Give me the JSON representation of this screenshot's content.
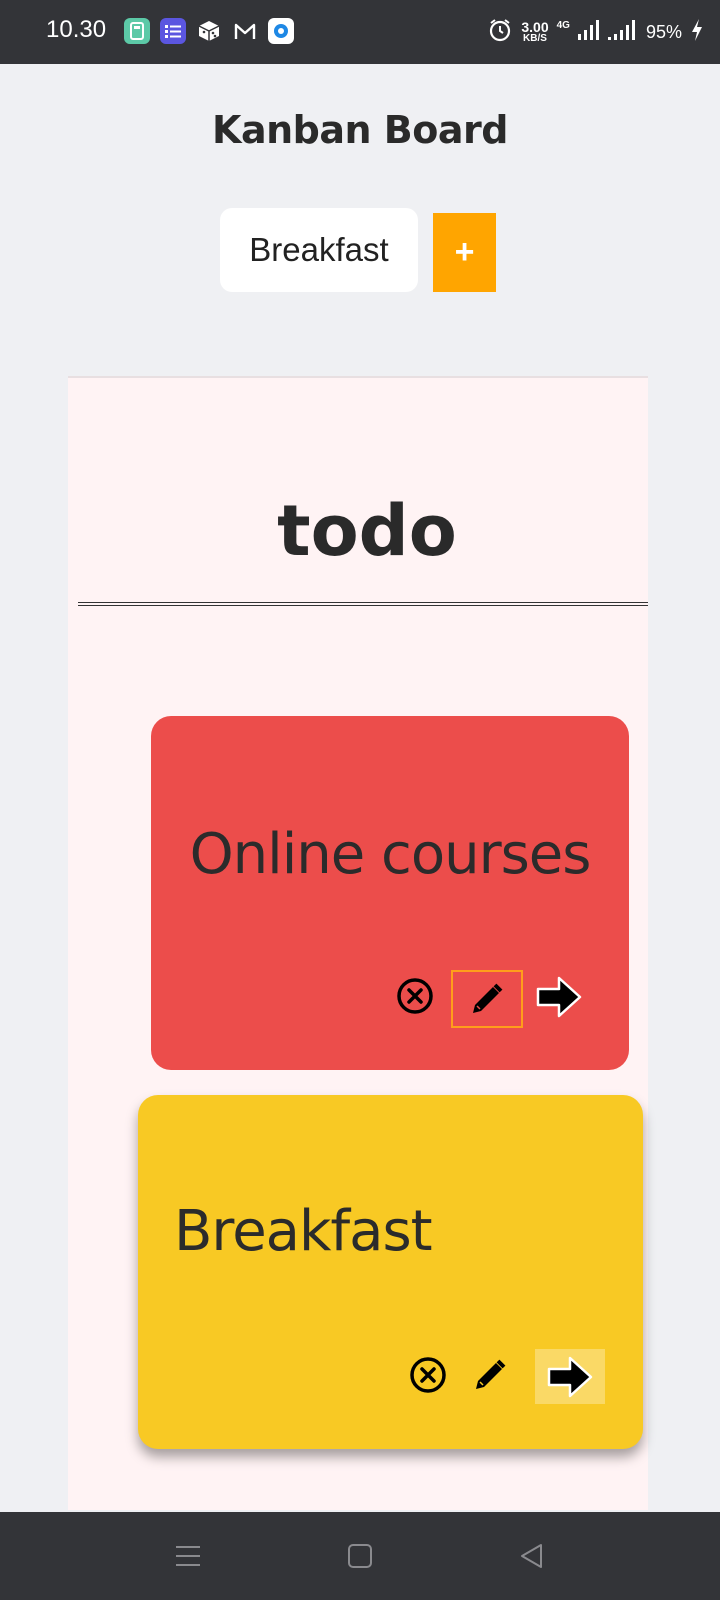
{
  "status_bar": {
    "time": "10.30",
    "net_speed_value": "3.00",
    "net_speed_unit": "KB/S",
    "network_type": "4G",
    "battery_percent": "95%",
    "app_icons": [
      "calculator-app-icon",
      "tasks-app-icon",
      "dice-app-icon",
      "gmail-icon",
      "browser-app-icon"
    ],
    "right_icons": [
      "alarm-icon",
      "signal-icon",
      "charging-icon"
    ]
  },
  "header": {
    "title": "Kanban Board",
    "input_value": "Breakfast",
    "add_button_label": "+"
  },
  "column": {
    "title": "todo",
    "cards": [
      {
        "title": "Online courses",
        "color": "#ec4d4b"
      },
      {
        "title": "Breakfast",
        "color": "#f8c924"
      }
    ]
  },
  "colors": {
    "accent": "#ffa500",
    "column_bg": "#fff3f4",
    "page_bg": "#eff0f3",
    "system_bar": "#333438"
  },
  "nav_bar": {
    "buttons": [
      "menu-icon",
      "home-icon",
      "back-icon"
    ]
  }
}
